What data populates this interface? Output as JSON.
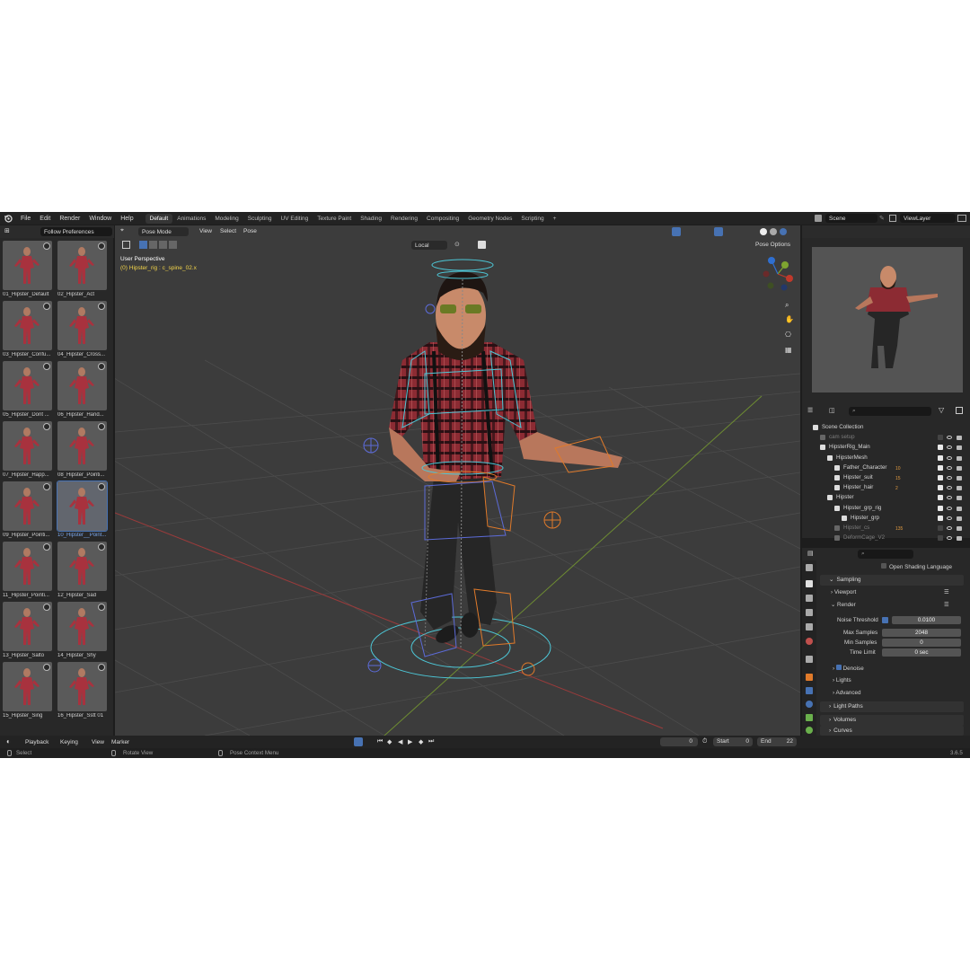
{
  "topbar": {
    "menus": [
      "File",
      "Edit",
      "Render",
      "Window",
      "Help"
    ],
    "workspaces": [
      "Default",
      "Animations",
      "Modeling",
      "Sculpting",
      "UV Editing",
      "Texture Paint",
      "Shading",
      "Rendering",
      "Compositing",
      "Geometry Nodes",
      "Scripting"
    ],
    "active_workspace": "Default",
    "add_workspace": "+",
    "scene": "Scene",
    "view_layer": "ViewLayer"
  },
  "asset_browser": {
    "library": "Follow Preferences",
    "items": [
      {
        "label": "01_Hipster_Default"
      },
      {
        "label": "02_Hipster_Act"
      },
      {
        "label": "03_Hipster_Confu..."
      },
      {
        "label": "04_Hipster_Cross..."
      },
      {
        "label": "05_Hipster_Dont ..."
      },
      {
        "label": "06_Hipster_Hand..."
      },
      {
        "label": "07_Hipster_Happ..."
      },
      {
        "label": "08_Hipster_Pointi..."
      },
      {
        "label": "09_Hipster_Pointi..."
      },
      {
        "label": "10_Hipster__Point..."
      },
      {
        "label": "11_Hipster_Pointi..."
      },
      {
        "label": "12_Hipster_Sad"
      },
      {
        "label": "13_Hipster_Salto"
      },
      {
        "label": "14_Hipster_Shy"
      },
      {
        "label": "15_Hipster_Sing"
      },
      {
        "label": "16_Hipster_Sstt 01"
      }
    ],
    "selected_index": 9
  },
  "viewport": {
    "mode": "Pose Mode",
    "menus": [
      "View",
      "Select",
      "Pose"
    ],
    "transform_orientation": "Local",
    "perspective": "User Perspective",
    "active_bone": "(0) Hipster_rig : c_spine_02.x",
    "pose_options": "Pose Options",
    "gizmo_axes": [
      "X",
      "Y",
      "Z"
    ]
  },
  "outliner": {
    "rows": [
      {
        "label": "Scene Collection",
        "indent": 0,
        "dim": false
      },
      {
        "label": "cam setup",
        "indent": 1,
        "dim": true
      },
      {
        "label": "HipsterRig_Main",
        "indent": 1,
        "dim": false
      },
      {
        "label": "HipsterMesh",
        "indent": 2,
        "dim": false
      },
      {
        "label": "Father_Character",
        "indent": 3,
        "dim": false,
        "badge": "10"
      },
      {
        "label": "Hipster_suit",
        "indent": 3,
        "dim": false,
        "badge": "15"
      },
      {
        "label": "Hipster_hair",
        "indent": 3,
        "dim": false,
        "badge": "2"
      },
      {
        "label": "Hipster",
        "indent": 2,
        "dim": false
      },
      {
        "label": "Hipster_grp_rig",
        "indent": 3,
        "dim": false
      },
      {
        "label": "Hipster_grp",
        "indent": 4,
        "dim": false
      },
      {
        "label": "Hipster_cs",
        "indent": 3,
        "dim": true,
        "badge": "135"
      },
      {
        "label": "DeformCage_V2",
        "indent": 3,
        "dim": true
      }
    ]
  },
  "properties": {
    "open_shading_language": "Open Shading Language",
    "sampling": "Sampling",
    "viewport": "Viewport",
    "render": "Render",
    "noise_threshold_label": "Noise Threshold",
    "noise_threshold": "0.0100",
    "max_samples_label": "Max Samples",
    "max_samples": "2048",
    "min_samples_label": "Min Samples",
    "min_samples": "0",
    "time_limit_label": "Time Limit",
    "time_limit": "0 sec",
    "denoise": "Denoise",
    "lights": "Lights",
    "advanced": "Advanced",
    "light_paths": "Light Paths",
    "volumes": "Volumes",
    "curves": "Curves"
  },
  "timeline": {
    "menus": [
      "Playback",
      "Keying",
      "View",
      "Marker"
    ],
    "current_frame": "0",
    "start_label": "Start",
    "start": "0",
    "end_label": "End",
    "end": "22"
  },
  "statusbar": {
    "select": "Select",
    "rotate": "Rotate View",
    "context": "Pose Context Menu",
    "version": "3.6.5"
  },
  "colors": {
    "accent": "#4772b3",
    "axis_x": "#c0392b",
    "axis_y": "#7ea430",
    "axis_z": "#2f6fd0",
    "bone_cyan": "#4dc8d8",
    "bone_orange": "#e07a2a",
    "bone_blue": "#5c6bd8"
  }
}
